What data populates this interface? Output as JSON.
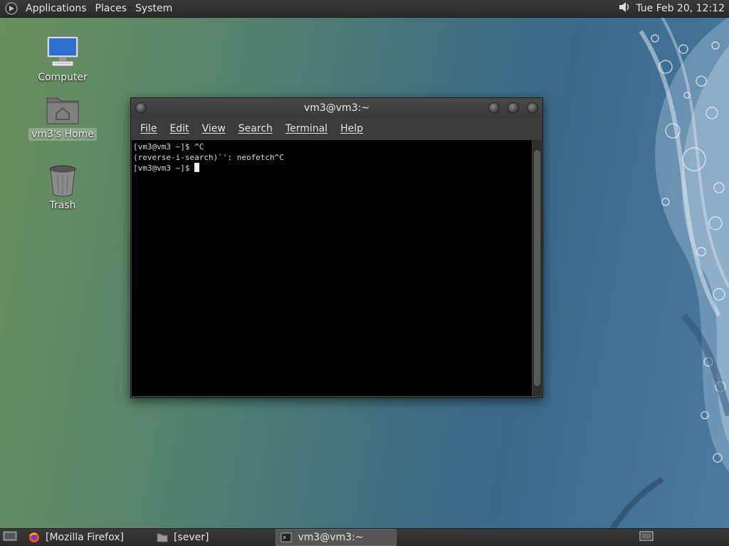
{
  "top_panel": {
    "menus": [
      "Applications",
      "Places",
      "System"
    ],
    "clock": "Tue Feb 20, 12:12"
  },
  "desktop_icons": [
    {
      "label": "Computer",
      "icon": "computer-icon"
    },
    {
      "label": "vm3's Home",
      "icon": "home-folder-icon",
      "selected": true
    },
    {
      "label": "Trash",
      "icon": "trash-icon"
    }
  ],
  "terminal": {
    "title": "vm3@vm3:~",
    "menu": [
      "File",
      "Edit",
      "View",
      "Search",
      "Terminal",
      "Help"
    ],
    "lines": [
      "[vm3@vm3 ~]$ ^C",
      "",
      "(reverse-i-search)`': neofetch^C",
      "[vm3@vm3 ~]$ "
    ]
  },
  "taskbar": {
    "items": [
      {
        "label": "[Mozilla Firefox]",
        "icon": "firefox-icon",
        "active": false
      },
      {
        "label": "[sever]",
        "icon": "folder-icon",
        "active": false
      },
      {
        "label": "vm3@vm3:~",
        "icon": "terminal-icon",
        "active": true
      }
    ]
  },
  "colors": {
    "terminal_bg": "#000000",
    "panel_bg": "#2f2f2f",
    "accent": "#3a6a8c"
  }
}
